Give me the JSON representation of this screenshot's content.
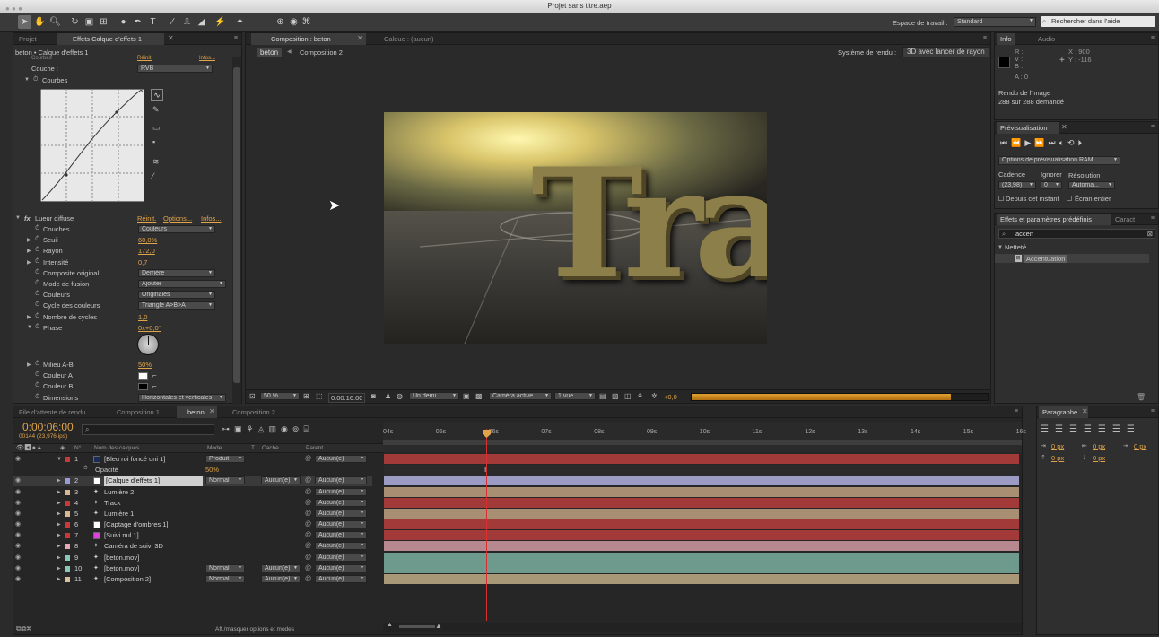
{
  "window_title": "Projet sans titre.aep",
  "toolbar": {
    "workspace_label": "Espace de travail :",
    "workspace_value": "Standard",
    "search_placeholder": "Rechercher dans l'aide"
  },
  "left_panel": {
    "tabs": [
      "Projet",
      "Effets Calque d'effets 1"
    ],
    "breadcrumb": "beton • Calque d'effets 1",
    "curves": {
      "header": "Courbes",
      "reset": "Réinit.",
      "infos": "Infos...",
      "channel_label": "Couche :",
      "channel_value": "RVB",
      "curves_label": "Courbes"
    },
    "glow": {
      "title": "Lueur diffuse",
      "reset": "Réinit.",
      "options": "Options...",
      "infos": "Infos...",
      "props": [
        {
          "label": "Couches",
          "type": "drop",
          "value": "Couleurs"
        },
        {
          "label": "Seuil",
          "type": "val",
          "value": "60,0%"
        },
        {
          "label": "Rayon",
          "type": "val",
          "value": "172,0"
        },
        {
          "label": "Intensité",
          "type": "val",
          "value": "0,7"
        },
        {
          "label": "Composite original",
          "type": "drop",
          "value": "Derrière"
        },
        {
          "label": "Mode de fusion",
          "type": "drop",
          "value": "Ajouter"
        },
        {
          "label": "Couleurs",
          "type": "drop",
          "value": "Originales"
        },
        {
          "label": "Cycle des couleurs",
          "type": "drop",
          "value": "Triangle A>B>A"
        },
        {
          "label": "Nombre de cycles",
          "type": "val",
          "value": "1,0"
        },
        {
          "label": "Phase",
          "type": "val",
          "value": "0x+0,0°"
        }
      ],
      "props2": [
        {
          "label": "Milieu A-B",
          "type": "val",
          "value": "50%"
        },
        {
          "label": "Couleur A",
          "type": "color",
          "value": "#ffffff"
        },
        {
          "label": "Couleur B",
          "type": "color",
          "value": "#000000"
        },
        {
          "label": "Dimensions",
          "type": "drop",
          "value": "Horizontales et verticales"
        }
      ]
    }
  },
  "comp_panel": {
    "tabs": [
      "Composition : beton",
      "Calque : (aucun)"
    ],
    "crumbs": [
      "beton",
      "Composition 2"
    ],
    "renderer_label": "Système de rendu :",
    "renderer_value": "3D avec lancer de rayon",
    "footer": {
      "zoom": "50 %",
      "timecode": "0:00:16:00",
      "resolution": "Un demi",
      "camera": "Caméra active",
      "views": "1 vue",
      "exposure": "+0,0"
    },
    "scene_text": "Track"
  },
  "info_panel": {
    "tabs": [
      "Info",
      "Audio"
    ],
    "rgb_labels": [
      "R :",
      "V :",
      "B :",
      "A : 0"
    ],
    "x": "X : 900",
    "y": "Y : -116",
    "render_line1": "Rendu de l'image",
    "render_line2": "288 sur 288 demandé"
  },
  "preview_panel": {
    "tab": "Prévisualisation",
    "ram_options": "Options de prévisualisation RAM",
    "cadence_label": "Cadence",
    "ignore_label": "Ignorer",
    "resolution_label": "Résolution",
    "cadence_value": "(23,98)",
    "ignore_value": "0",
    "resolution_value": "Automa...",
    "from_current": "Depuis cet instant",
    "fullscreen": "Écran entier"
  },
  "effects_panel": {
    "tabs": [
      "Effets et paramètres prédéfinis",
      "Caract"
    ],
    "search_value": "accen",
    "category": "Netteté",
    "item": "Accentuation"
  },
  "paragraph_panel": {
    "tab": "Paragraphe",
    "values": [
      "0 px",
      "0 px",
      "0 px",
      "0 px",
      "0 px"
    ]
  },
  "timeline": {
    "tabs": [
      "File d'attente de rendu",
      "Composition 1",
      "beton",
      "Composition 2"
    ],
    "timecode": "0:00:06:00",
    "frame_info": "00144 (23,976 ips)",
    "col_headers": {
      "num": "N°",
      "name": "Nom des calques",
      "mode": "Mode",
      "t": "T",
      "cache": "Cache",
      "parent": "Parent"
    },
    "ruler": [
      "04s",
      "05s",
      "06s",
      "07s",
      "08s",
      "09s",
      "10s",
      "11s",
      "12s",
      "13s",
      "14s",
      "15s",
      "16s"
    ],
    "opacity_label": "Opacité",
    "opacity_value": "50%",
    "layers": [
      {
        "n": "1",
        "name": "[Bleu roi foncé uni 1]",
        "mode": "Produit",
        "cache": "",
        "parent": "Aucun(e)",
        "label": "#c83a3a",
        "icon": "#1a2a5a",
        "bar": "#a33a3a"
      },
      {
        "n": "2",
        "name": "[Calque d'effets 1]",
        "mode": "Normal",
        "cache": "Aucun(e)",
        "parent": "Aucun(e)",
        "label": "#9a9ad8",
        "icon": "#ffffff",
        "bar": "#9b9bc4"
      },
      {
        "n": "3",
        "name": "Lumière 2",
        "mode": "",
        "cache": "",
        "parent": "Aucun(e)",
        "label": "#d8b890",
        "icon": "",
        "bar": "#a88e72"
      },
      {
        "n": "4",
        "name": "Track",
        "mode": "",
        "cache": "",
        "parent": "Aucun(e)",
        "label": "#c83a3a",
        "icon": "",
        "bar": "#a33a3a"
      },
      {
        "n": "5",
        "name": "Lumière 1",
        "mode": "",
        "cache": "",
        "parent": "Aucun(e)",
        "label": "#d8b890",
        "icon": "",
        "bar": "#a88e72"
      },
      {
        "n": "6",
        "name": "[Captage d'ombres 1]",
        "mode": "",
        "cache": "",
        "parent": "Aucun(e)",
        "label": "#c83a3a",
        "icon": "#ffffff",
        "bar": "#a33a3a"
      },
      {
        "n": "7",
        "name": "[Suivi nul 1]",
        "mode": "",
        "cache": "",
        "parent": "Aucun(e)",
        "label": "#c83a3a",
        "icon": "#e040e0",
        "bar": "#a33a3a"
      },
      {
        "n": "8",
        "name": "Caméra de suivi 3D",
        "mode": "",
        "cache": "",
        "parent": "Aucun(e)",
        "label": "#e8a8b8",
        "icon": "",
        "bar": "#b88890"
      },
      {
        "n": "9",
        "name": "[beton.mov]",
        "mode": "",
        "cache": "",
        "parent": "Aucun(e)",
        "label": "#88c8b8",
        "icon": "",
        "bar": "#6e9a8e"
      },
      {
        "n": "10",
        "name": "[beton.mov]",
        "mode": "Normal",
        "cache": "Aucun(e)",
        "parent": "Aucun(e)",
        "label": "#88c8b8",
        "icon": "",
        "bar": "#6e9a8e"
      },
      {
        "n": "11",
        "name": "[Composition 2]",
        "mode": "Normal",
        "cache": "Aucun(e)",
        "parent": "Aucun(e)",
        "label": "#d8c0a0",
        "icon": "",
        "bar": "#a89878"
      }
    ],
    "footer_toggle": "Aff./masquer options et modes"
  },
  "colors": {
    "accent": "#e0a44a",
    "panel": "#2f2f2f",
    "playhead": "#d83030"
  }
}
